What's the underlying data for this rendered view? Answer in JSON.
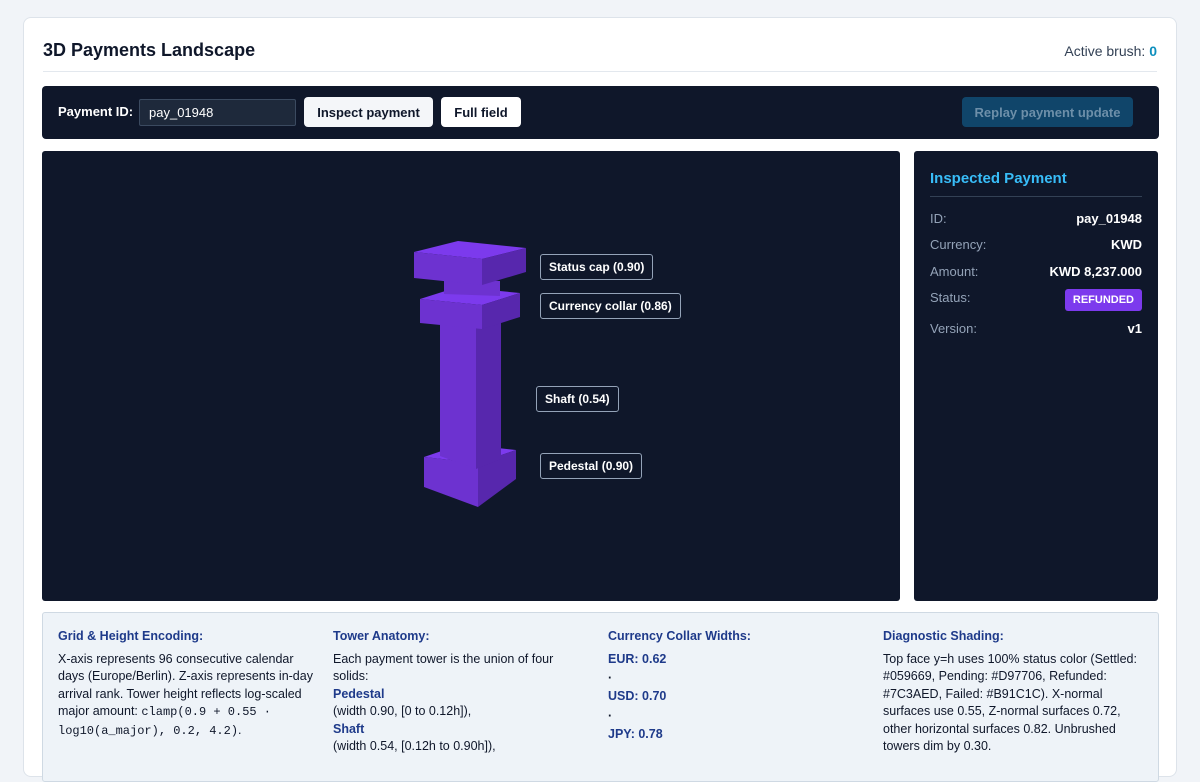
{
  "header": {
    "title": "3D Payments Landscape",
    "brush_label": "Active brush:",
    "brush_value": "0"
  },
  "toolbar": {
    "payment_label": "Payment ID:",
    "payment_value": "pay_01948",
    "inspect_label": "Inspect payment",
    "full_label": "Full field",
    "replay_label": "Replay payment update"
  },
  "tower": {
    "color": "#7C3AED",
    "callouts": [
      {
        "label": "Status cap (0.90)"
      },
      {
        "label": "Currency collar (0.86)"
      },
      {
        "label": "Shaft (0.54)"
      },
      {
        "label": "Pedestal (0.90)"
      }
    ]
  },
  "panel": {
    "title": "Inspected Payment",
    "rows": [
      {
        "key": "ID:",
        "value": "pay_01948"
      },
      {
        "key": "Currency:",
        "value": "KWD"
      },
      {
        "key": "Amount:",
        "value": "KWD 8,237.000"
      },
      {
        "key": "Status:",
        "value": "REFUNDED"
      },
      {
        "key": "Version:",
        "value": "v1"
      }
    ],
    "status_color": "#7C3AED"
  },
  "legend": {
    "grid": {
      "title": "Grid & Height Encoding:",
      "text": "X-axis represents 96 consecutive calendar days (Europe/Berlin). Z-axis represents in-day arrival rank. Tower height reflects log-scaled major amount: ",
      "formula": "clamp(0.9 + 0.55 · log10(a_major), 0.2, 4.2)",
      "suffix": "."
    },
    "anatomy": {
      "title": "Tower Anatomy:",
      "text": "Each payment tower is the union of four solids:",
      "pedestal": "Pedestal",
      "pedestal_desc": "(width 0.90, [0 to 0.12h]),",
      "shaft": "Shaft",
      "shaft_desc": "(width 0.54, [0.12h to 0.90h]),"
    },
    "collar": {
      "title": "Currency Collar Widths:",
      "eur": "EUR: 0.62",
      "usd": "USD: 0.70",
      "jpy": "JPY: 0.78",
      "sep": "·"
    },
    "shading": {
      "title": "Diagnostic Shading:",
      "text": "Top face y=h uses 100% status color (Settled: #059669, Pending: #D97706, Refunded: #7C3AED, Failed: #B91C1C). X-normal surfaces use 0.55, Z-normal surfaces 0.72, other horizontal surfaces 0.82. Unbrushed towers dim by 0.30."
    }
  }
}
